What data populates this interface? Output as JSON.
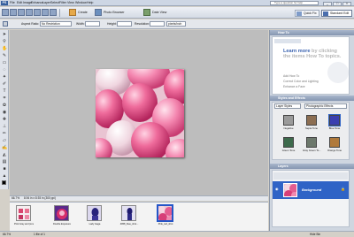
{
  "menubar": {
    "items": [
      "File",
      "Edit",
      "Image",
      "Enhance",
      "Layer",
      "Select",
      "Filter",
      "View",
      "Window",
      "Help"
    ],
    "search_placeholder": "Type a question for help"
  },
  "toolbar": {
    "create": "Create",
    "photo_browser": "Photo Browser",
    "date_view": "Date View",
    "quick_fix": "Quick Fix",
    "standard_edit": "Standard Edit"
  },
  "options": {
    "aspect_ratio_label": "Aspect Ratio:",
    "aspect_ratio_value": "No Restriction",
    "width_label": "Width:",
    "height_label": "Height:",
    "resolution_label": "Resolution:",
    "resolution_unit": "pixels/inch"
  },
  "document": {
    "zoom": "66.7%",
    "info": "8.94 in x 8.93 in (300 ppi)"
  },
  "photo_bin": [
    {
      "caption": "Pink Gray and (small)"
    },
    {
      "caption": "Double Exposure"
    },
    {
      "caption": "Lady Gaga"
    },
    {
      "caption": "4958_blue_shot..."
    },
    {
      "caption": "Pink_red_shot"
    }
  ],
  "how_to": {
    "title": "How To",
    "text_accent": "Learn more",
    "text_rest": "by clicking the items How To topics.",
    "links": [
      "Add How To",
      "Correct Color and Lighting",
      "Enhance a Face"
    ]
  },
  "styles_effects": {
    "title": "Styles and Effects",
    "dropdown1": "Layer Styles",
    "dropdown2": "Photographic Effects",
    "swatches": [
      {
        "label": "Negative",
        "color": "#9a9a9a"
      },
      {
        "label": "Sepia Tone",
        "color": "#8c6e52"
      },
      {
        "label": "Blue Tone",
        "color": "#3b3fb0"
      },
      {
        "label": "Green Tone",
        "color": "#3d6a4c"
      },
      {
        "label": "Gray Green To...",
        "color": "#6c786c"
      },
      {
        "label": "Orange Tone",
        "color": "#b07a3c"
      }
    ]
  },
  "layers": {
    "title": "Layers",
    "layer_name": "Background"
  },
  "status": {
    "zoom": "66.7%",
    "page": "1 file of 1",
    "hide_bin": "Hide Bin"
  },
  "colors": {
    "accent": "#2f63c6",
    "canvas_bg": "#bdbdbd"
  }
}
